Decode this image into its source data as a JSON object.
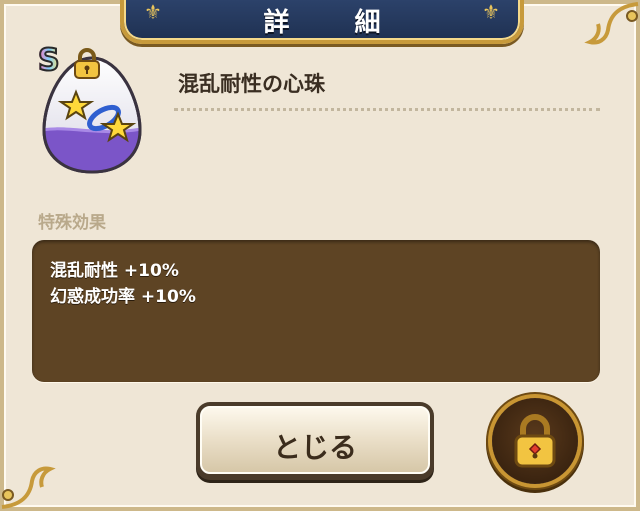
{
  "dialog": {
    "title": "詳 細",
    "close_label": "とじる"
  },
  "item": {
    "rank": "S",
    "name": "混乱耐性の心珠",
    "icon": "star-orb-egg-icon",
    "locked": true
  },
  "effects": {
    "section_label": "特殊効果",
    "lines": [
      "混乱耐性 +10%",
      "幻惑成功率 +10%"
    ]
  },
  "colors": {
    "panel_bg": "#efe6d6",
    "title_plate": "#2f4670",
    "gold_trim": "#c79a3b",
    "effect_box": "#5e4424",
    "egg_purple": "#7b55c8"
  }
}
